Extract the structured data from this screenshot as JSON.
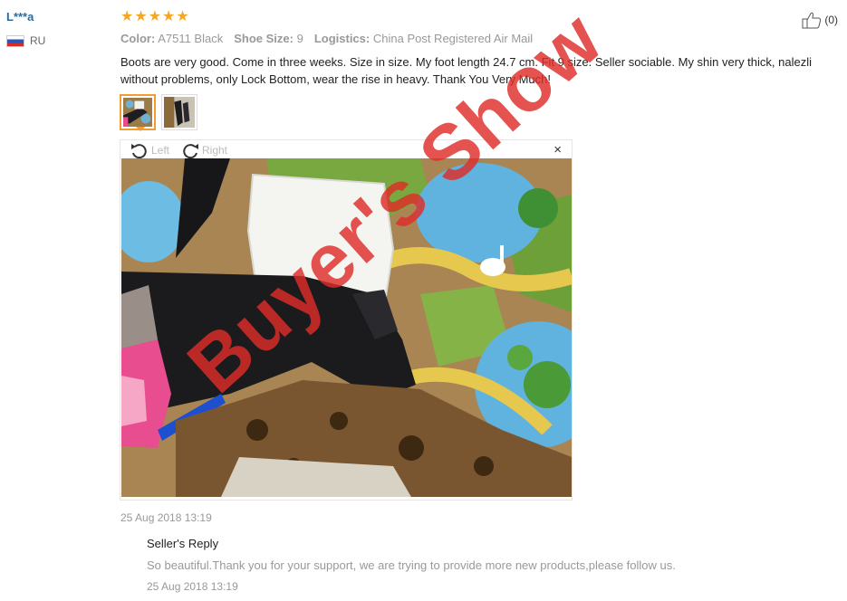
{
  "user": {
    "name": "L***a",
    "country": "RU"
  },
  "rating": {
    "stars": 5
  },
  "helpful": {
    "count": "(0)"
  },
  "attributes": [
    {
      "key": "Color:",
      "value": "A7511 Black"
    },
    {
      "key": "Shoe Size:",
      "value": "9"
    },
    {
      "key": "Logistics:",
      "value": "China Post Registered Air Mail"
    }
  ],
  "review": {
    "text": "Boots are very good. Come in three weeks. Size in size. My foot length 24.7 cm. Fit 9 size. Seller sociable. My shin very thick, nalezli without problems, only Lock Bottom, wear the rise in heavy. Thank You Very Much!",
    "date": "25 Aug 2018 13:19"
  },
  "viewer": {
    "rotate_left": "Left",
    "rotate_right": "Right",
    "close": "×"
  },
  "seller_reply": {
    "title": "Seller's Reply",
    "text": "So beautiful.Thank you for your support, we are trying to provide more new products,please follow us.",
    "date": "25 Aug 2018 13:19"
  },
  "watermark": "Buyer's Show",
  "colors": {
    "accent": "#f39c33",
    "star": "#f5a623",
    "username": "#2c6ba0",
    "watermark": "#de2d28"
  }
}
